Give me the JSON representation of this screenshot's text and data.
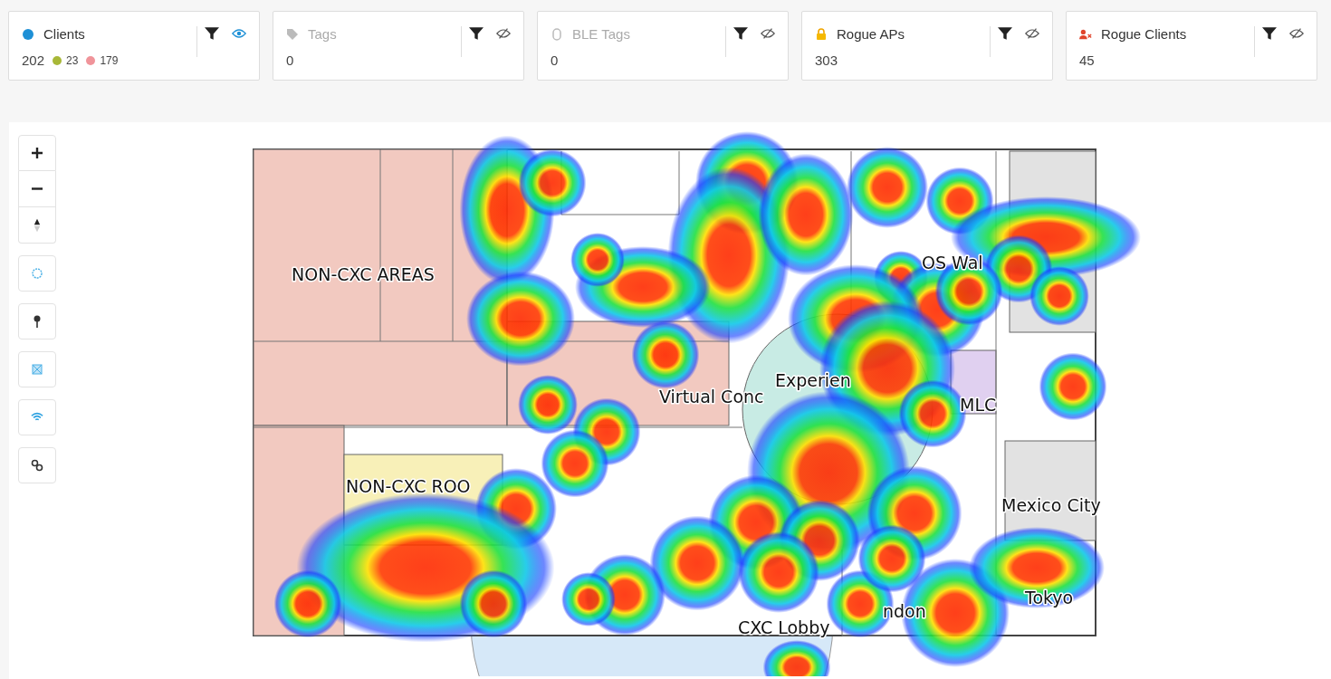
{
  "cards": [
    {
      "kind": "clients",
      "label": "Clients",
      "count": "202",
      "enabled": true,
      "visible": true,
      "breakdown": [
        {
          "count": "23",
          "color": "#a8b838"
        },
        {
          "count": "179",
          "color": "#f0949a"
        }
      ]
    },
    {
      "kind": "tags",
      "label": "Tags",
      "count": "0",
      "enabled": false,
      "visible": false
    },
    {
      "kind": "ble",
      "label": "BLE Tags",
      "count": "0",
      "enabled": false,
      "visible": false
    },
    {
      "kind": "rogue_aps",
      "label": "Rogue APs",
      "count": "303",
      "enabled": true,
      "visible": false
    },
    {
      "kind": "rogue_clients",
      "label": "Rogue Clients",
      "count": "45",
      "enabled": true,
      "visible": false
    }
  ],
  "map_tools": [
    {
      "kind": "zoom_in"
    },
    {
      "kind": "zoom_out"
    },
    {
      "kind": "rotate"
    },
    {
      "kind": "circle"
    },
    {
      "kind": "pin"
    },
    {
      "kind": "area"
    },
    {
      "kind": "wifi"
    },
    {
      "kind": "link"
    }
  ],
  "map": {
    "labels": [
      {
        "text": "NON-CXC AREAS"
      },
      {
        "text": "NON-CXC ROO"
      },
      {
        "text": "Experien"
      },
      {
        "text": "Virtual Conc"
      },
      {
        "text": "OS Wal"
      },
      {
        "text": "MLC"
      },
      {
        "text": "Mexico City"
      },
      {
        "text": "Tokyo"
      },
      {
        "text": "ndon"
      },
      {
        "text": "CXC Lobby"
      }
    ]
  }
}
